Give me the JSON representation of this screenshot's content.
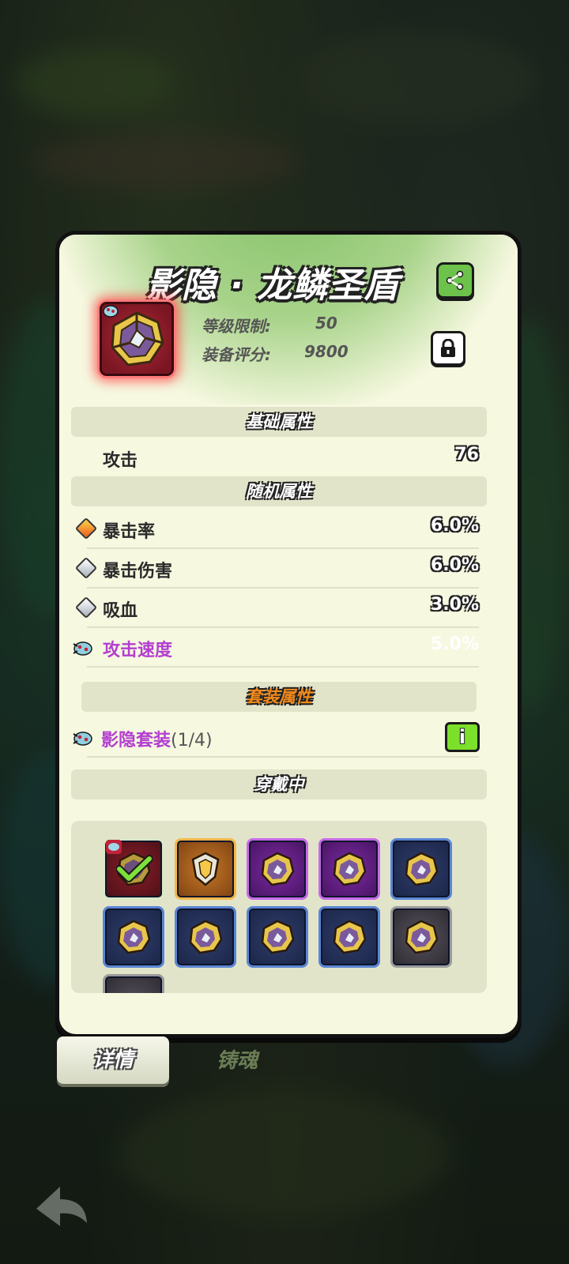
{
  "item": {
    "title": "影隐 · 龙鳞圣盾",
    "level_label": "等级限制:",
    "level_value": "50",
    "score_label": "装备评分:",
    "score_value": "9800"
  },
  "sections": {
    "basic": "基础属性",
    "random": "随机属性",
    "set": "套装属性",
    "wearing": "穿戴中"
  },
  "basic_stats": [
    {
      "label": "攻击",
      "value": "76"
    }
  ],
  "random_stats": [
    {
      "label": "暴击率",
      "value": "6.0%",
      "gem": "orange-gem-icon"
    },
    {
      "label": "暴击伤害",
      "value": "6.0%",
      "gem": "silver-gem-icon"
    },
    {
      "label": "吸血",
      "value": "3.0%",
      "gem": "silver-gem-icon"
    },
    {
      "label": "攻击速度",
      "value": "5.0%",
      "gem": "bug-icon"
    }
  ],
  "set_bonus": {
    "label": "影隐套装",
    "count": "(1/4)",
    "info_label": "i"
  },
  "tabs": {
    "details": "详情",
    "soul": "铸魂"
  },
  "colors": {
    "purple_text": "#b33fd0",
    "share_green": "#6cc24a",
    "info_green": "#7be02a"
  }
}
